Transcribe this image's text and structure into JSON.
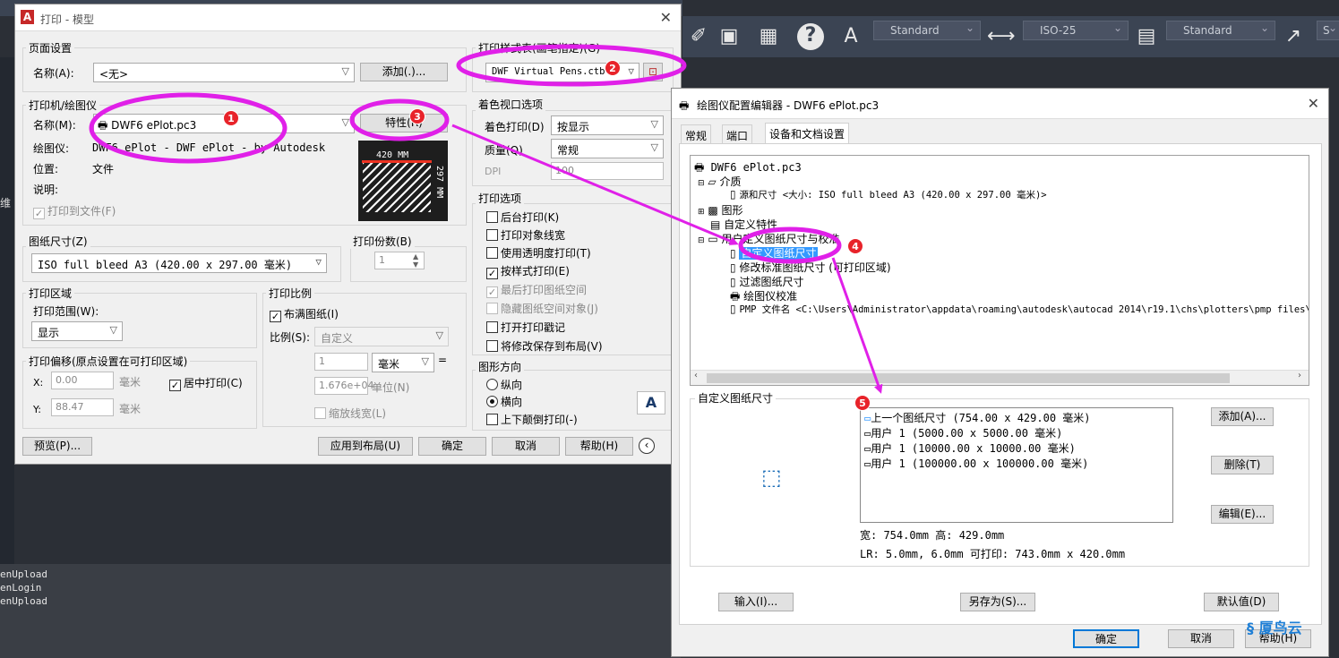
{
  "toolbar": {
    "text_style": "Standard",
    "dim_style": "ISO-25",
    "table_style": "Standard",
    "mleader_style": "S"
  },
  "background_tab_label": "维",
  "command_history": [
    "enUpload",
    "enLogin",
    "enUpload"
  ],
  "print_dialog": {
    "title": "打印 - 模型",
    "page_setup": {
      "group": "页面设置",
      "name_label": "名称(A):",
      "name_value": "<无>",
      "add_button": "添加(.)..."
    },
    "plot_style_table": {
      "group": "打印样式表(画笔指定)(G)",
      "value": "DWF Virtual Pens.ctb"
    },
    "printer": {
      "group": "打印机/绘图仪",
      "name_label": "名称(M):",
      "name_value": "DWF6 ePlot.pc3",
      "properties_button": "特性(R)",
      "plotter_label": "绘图仪:",
      "plotter_value": "DWF6 ePlot - DWF ePlot - by Autodesk",
      "location_label": "位置:",
      "location_value": "文件",
      "description_label": "说明:",
      "plot_to_file": "打印到文件(F)",
      "preview_width": "420 MM",
      "preview_height": "297 MM"
    },
    "shaded_viewport": {
      "group": "着色视口选项",
      "shade_plot_label": "着色打印(D)",
      "shade_plot_value": "按显示",
      "quality_label": "质量(Q)",
      "quality_value": "常规",
      "dpi_label": "DPI",
      "dpi_value": "100"
    },
    "paper_size": {
      "group": "图纸尺寸(Z)",
      "value": "ISO full bleed A3 (420.00 x 297.00 毫米)"
    },
    "copies": {
      "group": "打印份数(B)",
      "value": "1"
    },
    "plot_options": {
      "group": "打印选项",
      "items": [
        {
          "label": "后台打印(K)",
          "checked": false,
          "disabled": false
        },
        {
          "label": "打印对象线宽",
          "checked": false,
          "disabled": false
        },
        {
          "label": "使用透明度打印(T)",
          "checked": false,
          "disabled": false
        },
        {
          "label": "按样式打印(E)",
          "checked": true,
          "disabled": false
        },
        {
          "label": "最后打印图纸空间",
          "checked": true,
          "disabled": true
        },
        {
          "label": "隐藏图纸空间对象(J)",
          "checked": false,
          "disabled": true
        },
        {
          "label": "打开打印戳记",
          "checked": false,
          "disabled": false
        },
        {
          "label": "将修改保存到布局(V)",
          "checked": false,
          "disabled": false
        }
      ]
    },
    "plot_area": {
      "group": "打印区域",
      "range_label": "打印范围(W):",
      "range_value": "显示"
    },
    "plot_scale": {
      "group": "打印比例",
      "fit_paper": "布满图纸(I)",
      "scale_label": "比例(S):",
      "scale_value": "自定义",
      "num_value": "1",
      "unit_value": "毫米",
      "equals": "=",
      "den_value": "1.676e+04",
      "den_unit": "单位(N)",
      "scale_lineweights": "缩放线宽(L)"
    },
    "plot_offset": {
      "group": "打印偏移(原点设置在可打印区域)",
      "x_label": "X:",
      "x_value": "0.00",
      "y_label": "Y:",
      "y_value": "88.47",
      "unit": "毫米",
      "center": "居中打印(C)"
    },
    "orientation": {
      "group": "图形方向",
      "portrait": "纵向",
      "landscape": "横向",
      "upside_down": "上下颠倒打印(-)",
      "icon_letter": "A"
    },
    "buttons": {
      "preview": "预览(P)...",
      "apply_layout": "应用到布局(U)",
      "ok": "确定",
      "cancel": "取消",
      "help": "帮助(H)"
    }
  },
  "plotter_editor": {
    "title": "绘图仪配置编辑器 - DWF6 ePlot.pc3",
    "tabs": [
      "常规",
      "端口",
      "设备和文档设置"
    ],
    "tree": {
      "root": "DWF6 ePlot.pc3",
      "media": "介质",
      "source_size": "源和尺寸 <大小: ISO full bleed A3 (420.00 x 297.00 毫米)>",
      "graphics": "图形",
      "custom_properties": "自定义特性",
      "user_defined": "用户定义图纸尺寸与校准",
      "custom_paper_sizes": "自定义图纸尺寸",
      "modify_std_sizes": "修改标准图纸尺寸 (可打印区域)",
      "filter_sizes": "过滤图纸尺寸",
      "plotter_calibration": "绘图仪校准",
      "pmp_file": "PMP 文件名 <C:\\Users\\Administrator\\appdata\\roaming\\autodesk\\autocad 2014\\r19.1\\chs\\plotters\\pmp files\\DWF"
    },
    "custom_section": {
      "group": "自定义图纸尺寸",
      "sizes": [
        "上一个图纸尺寸 (754.00 x 429.00 毫米)",
        "用户 1 (5000.00 x 5000.00 毫米)",
        "用户 1 (10000.00 x 10000.00 毫米)",
        "用户 1 (100000.00 x 100000.00 毫米)"
      ],
      "add_button": "添加(A)...",
      "delete_button": "删除(T)",
      "edit_button": "编辑(E)...",
      "dimensions_info": "宽: 754.0mm 高: 429.0mm",
      "margins_info": "LR: 5.0mm, 6.0mm  可打印: 743.0mm x 420.0mm"
    },
    "buttons": {
      "import": "输入(I)...",
      "save_as": "另存为(S)...",
      "defaults": "默认值(D)",
      "ok": "确定",
      "cancel": "取消",
      "help": "帮助(H)"
    }
  },
  "annotations": [
    "1",
    "2",
    "3",
    "4",
    "5"
  ],
  "watermark": "厦鸟云",
  "colors": {
    "annotation_magenta": "#e020e8",
    "badge_red": "#e8232a",
    "selection_blue": "#3399ff"
  }
}
